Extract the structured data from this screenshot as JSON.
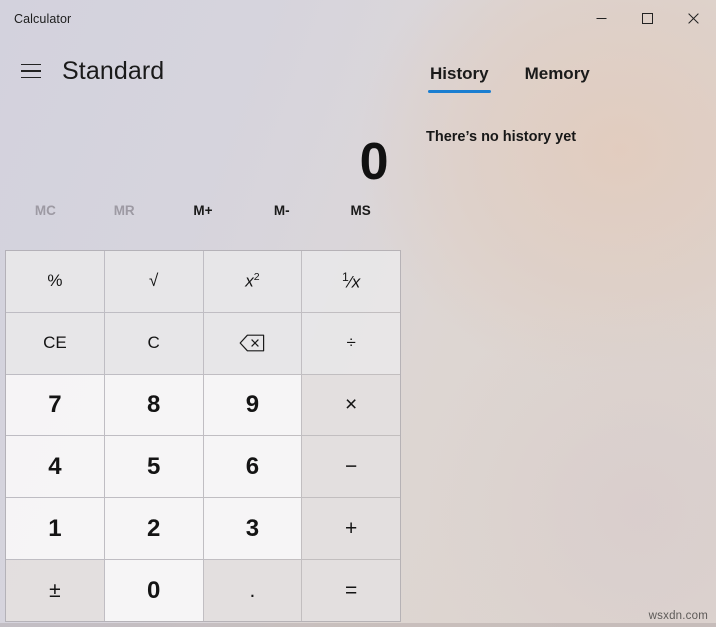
{
  "window": {
    "title": "Calculator",
    "controls": [
      {
        "name": "minimize",
        "glyph": "minimize-icon"
      },
      {
        "name": "maximize",
        "glyph": "maximize-icon"
      },
      {
        "name": "close",
        "glyph": "close-icon"
      }
    ]
  },
  "calculator": {
    "menu_icon": "hamburger-menu-icon",
    "mode": "Standard",
    "display_value": "0",
    "memory_buttons": [
      {
        "label": "MC",
        "enabled": false
      },
      {
        "label": "MR",
        "enabled": false
      },
      {
        "label": "M+",
        "enabled": true
      },
      {
        "label": "M-",
        "enabled": true
      },
      {
        "label": "MS",
        "enabled": true
      }
    ],
    "keys": [
      {
        "label": "%",
        "name": "percent",
        "kind": "fn"
      },
      {
        "label": "√",
        "name": "square-root",
        "kind": "fn"
      },
      {
        "label": "x2",
        "name": "square",
        "kind": "fn",
        "render": "square"
      },
      {
        "label": "1/x",
        "name": "reciprocal",
        "kind": "fn",
        "render": "reciprocal"
      },
      {
        "label": "CE",
        "name": "clear-entry",
        "kind": "fn"
      },
      {
        "label": "C",
        "name": "clear",
        "kind": "fn"
      },
      {
        "label": "",
        "name": "backspace",
        "kind": "fn",
        "render": "backspace"
      },
      {
        "label": "÷",
        "name": "divide",
        "kind": "fn"
      },
      {
        "label": "7",
        "name": "digit-7",
        "kind": "num"
      },
      {
        "label": "8",
        "name": "digit-8",
        "kind": "num"
      },
      {
        "label": "9",
        "name": "digit-9",
        "kind": "num"
      },
      {
        "label": "×",
        "name": "multiply",
        "kind": "op"
      },
      {
        "label": "4",
        "name": "digit-4",
        "kind": "num"
      },
      {
        "label": "5",
        "name": "digit-5",
        "kind": "num"
      },
      {
        "label": "6",
        "name": "digit-6",
        "kind": "num"
      },
      {
        "label": "−",
        "name": "subtract",
        "kind": "op"
      },
      {
        "label": "1",
        "name": "digit-1",
        "kind": "num"
      },
      {
        "label": "2",
        "name": "digit-2",
        "kind": "num"
      },
      {
        "label": "3",
        "name": "digit-3",
        "kind": "num"
      },
      {
        "label": "+",
        "name": "add",
        "kind": "op"
      },
      {
        "label": "±",
        "name": "negate",
        "kind": "op"
      },
      {
        "label": "0",
        "name": "digit-0",
        "kind": "num"
      },
      {
        "label": ".",
        "name": "decimal",
        "kind": "op"
      },
      {
        "label": "=",
        "name": "equals",
        "kind": "op"
      }
    ]
  },
  "side_panel": {
    "tabs": [
      {
        "label": "History",
        "active": true
      },
      {
        "label": "Memory",
        "active": false
      }
    ],
    "history_empty_message": "There’s no history yet"
  },
  "watermark": "wsxdn.com",
  "colors": {
    "accent": "#1a7ed1",
    "text": "#141414",
    "disabled_text": "#9d9aa3"
  }
}
